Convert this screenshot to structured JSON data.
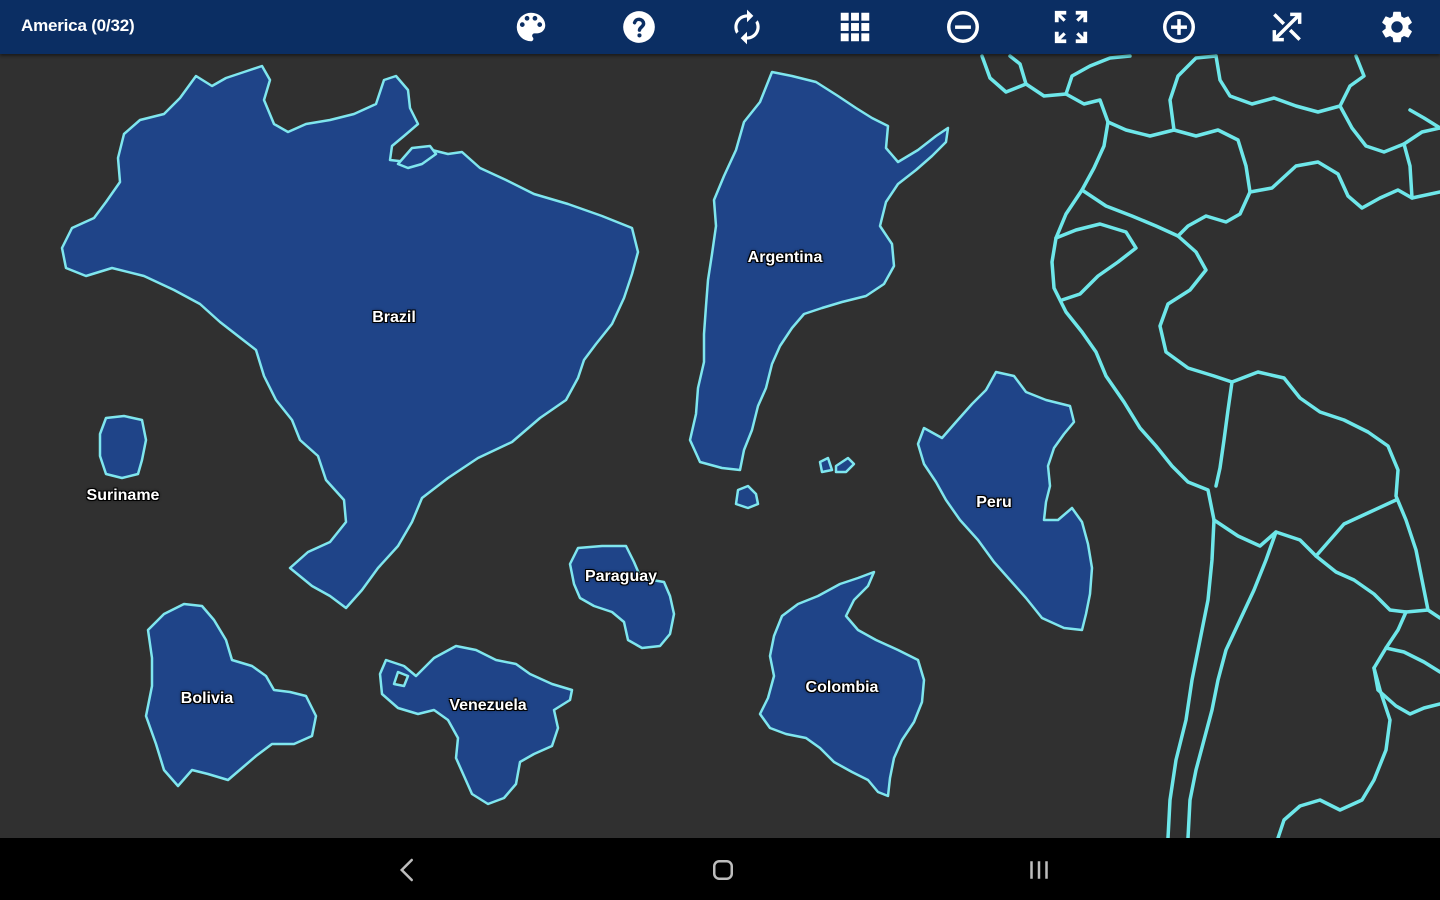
{
  "header": {
    "title": "America (0/32)",
    "background_color": "#0b2e63"
  },
  "toolbar": [
    {
      "name": "palette-icon",
      "label": "Colors"
    },
    {
      "name": "help-icon",
      "label": "Help"
    },
    {
      "name": "refresh-icon",
      "label": "Restart"
    },
    {
      "name": "grid-icon",
      "label": "Grid"
    },
    {
      "name": "zoom-out-icon",
      "label": "Zoom out"
    },
    {
      "name": "fullscreen-icon",
      "label": "Fit screen"
    },
    {
      "name": "zoom-in-icon",
      "label": "Zoom in"
    },
    {
      "name": "scatter-icon",
      "label": "Scatter pieces"
    },
    {
      "name": "settings-icon",
      "label": "Settings"
    }
  ],
  "pieces": {
    "brazil": "Brazil",
    "argentina": "Argentina",
    "suriname": "Suriname",
    "peru": "Peru",
    "paraguay": "Paraguay",
    "bolivia": "Bolivia",
    "venezuela": "Venezuela",
    "colombia": "Colombia"
  },
  "colors": {
    "piece_fill": "#1f4488",
    "piece_outline": "#7fe6ee",
    "map_border": "#6ee7ea",
    "board_background": "#303030"
  },
  "navigation": [
    {
      "name": "back-icon"
    },
    {
      "name": "home-icon"
    },
    {
      "name": "recents-icon"
    }
  ]
}
